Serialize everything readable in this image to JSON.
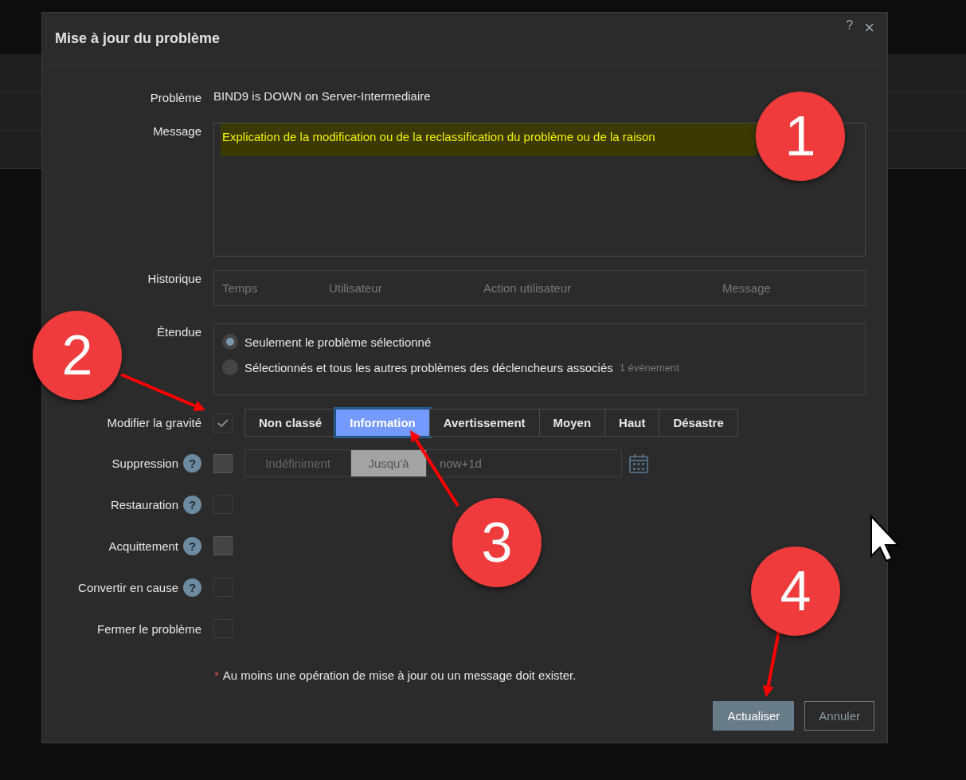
{
  "dialog": {
    "title": "Mise à jour du problème",
    "help": "?",
    "close": "×"
  },
  "problem": {
    "label": "Problème",
    "value": "BIND9 is DOWN on Server-Intermediaire"
  },
  "message": {
    "label": "Message",
    "value": "Explication de la modification ou de la reclassification du problème ou de la raison"
  },
  "history": {
    "label": "Historique",
    "columns": [
      "Temps",
      "Utilisateur",
      "Action utilisateur",
      "Message"
    ]
  },
  "scope": {
    "label": "Étendue",
    "options": [
      {
        "label": "Seulement le problème sélectionné",
        "selected": true
      },
      {
        "label": "Sélectionnés et tous les autres problèmes des déclencheurs associés",
        "note": "1 événement",
        "selected": false
      }
    ]
  },
  "severity": {
    "label": "Modifier la gravité",
    "checked": true,
    "disabled": true,
    "options": [
      {
        "label": "Non classé",
        "selected": false
      },
      {
        "label": "Information",
        "selected": true
      },
      {
        "label": "Avertissement",
        "selected": false
      },
      {
        "label": "Moyen",
        "selected": false
      },
      {
        "label": "Haut",
        "selected": false
      },
      {
        "label": "Désastre",
        "selected": false
      }
    ]
  },
  "suppression": {
    "label": "Suppression",
    "help": "?",
    "checked": false,
    "disabled": false,
    "modes": [
      {
        "label": "Indéfiniment",
        "selected": false
      },
      {
        "label": "Jusqu'à",
        "selected": true
      }
    ],
    "until": "now+1d"
  },
  "options": [
    {
      "label": "Restauration",
      "help": "?",
      "checked": false,
      "disabled": true
    },
    {
      "label": "Acquittement",
      "help": "?",
      "checked": false,
      "disabled": false
    },
    {
      "label": "Convertir en cause",
      "help": "?",
      "checked": false,
      "disabled": true
    },
    {
      "label": "Fermer le problème",
      "checked": false,
      "disabled": true
    }
  ],
  "footnote": {
    "mark": "*",
    "text": "Au moins une opération de mise à jour ou un message doit exister."
  },
  "buttons": [
    {
      "label": "Actualiser",
      "kind": "primary"
    },
    {
      "label": "Annuler",
      "kind": "secondary"
    }
  ],
  "annotations": [
    "1",
    "2",
    "3",
    "4"
  ]
}
